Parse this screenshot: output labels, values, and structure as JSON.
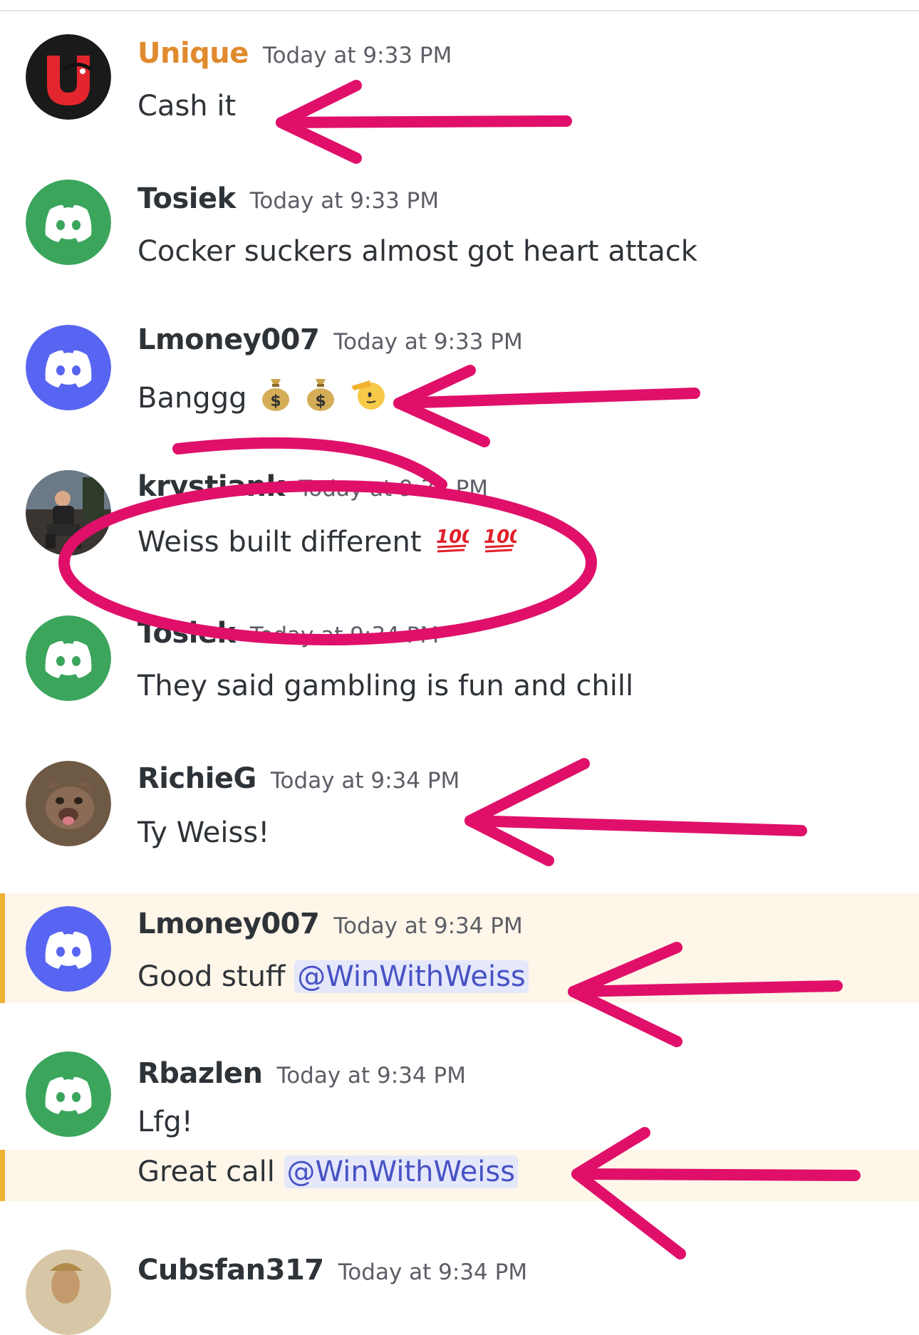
{
  "colors": {
    "discord_green": "#3ba55c",
    "discord_blurple": "#5865f2",
    "mention_highlight": "#fdf6e9",
    "mention_bar": "#f0b232",
    "annotation_pink": "#e0106a",
    "unique_name": "#e08a2e"
  },
  "messages": [
    {
      "username": "Unique",
      "timestamp": "Today at 9:33 PM",
      "text": "Cash it",
      "avatar": "unique-logo-icon"
    },
    {
      "username": "Tosiek",
      "timestamp": "Today at 9:33 PM",
      "text": "Cocker suckers almost got heart attack",
      "avatar": "discord-logo-icon"
    },
    {
      "username": "Lmoney007",
      "timestamp": "Today at 9:33 PM",
      "text": "Banggg",
      "emojis": [
        "money-bag-icon",
        "money-bag-icon",
        "saluting-face-icon"
      ],
      "avatar": "discord-logo-icon"
    },
    {
      "username": "krystiank",
      "timestamp": "Today at 9:33 PM",
      "text": "Weiss built different",
      "emojis": [
        "hundred-points-icon",
        "hundred-points-icon"
      ],
      "avatar": "user-photo"
    },
    {
      "username": "Tosiek",
      "timestamp": "Today at 9:34 PM",
      "text": "They said gambling is fun and chill",
      "avatar": "discord-logo-icon"
    },
    {
      "username": "RichieG",
      "timestamp": "Today at 9:34 PM",
      "text": "Ty Weiss!",
      "avatar": "dog-photo"
    },
    {
      "username": "Lmoney007",
      "timestamp": "Today at 9:34 PM",
      "text": "Good stuff",
      "mention": "@WinWithWeiss",
      "avatar": "discord-logo-icon"
    },
    {
      "username": "Rbazlen",
      "timestamp": "Today at 9:34 PM",
      "text": "Lfg!",
      "text2": "Great call",
      "mention": "@WinWithWeiss",
      "avatar": "discord-logo-icon"
    },
    {
      "username": "Cubsfan317",
      "timestamp": "Today at 9:34 PM",
      "avatar": "painting-photo"
    }
  ]
}
